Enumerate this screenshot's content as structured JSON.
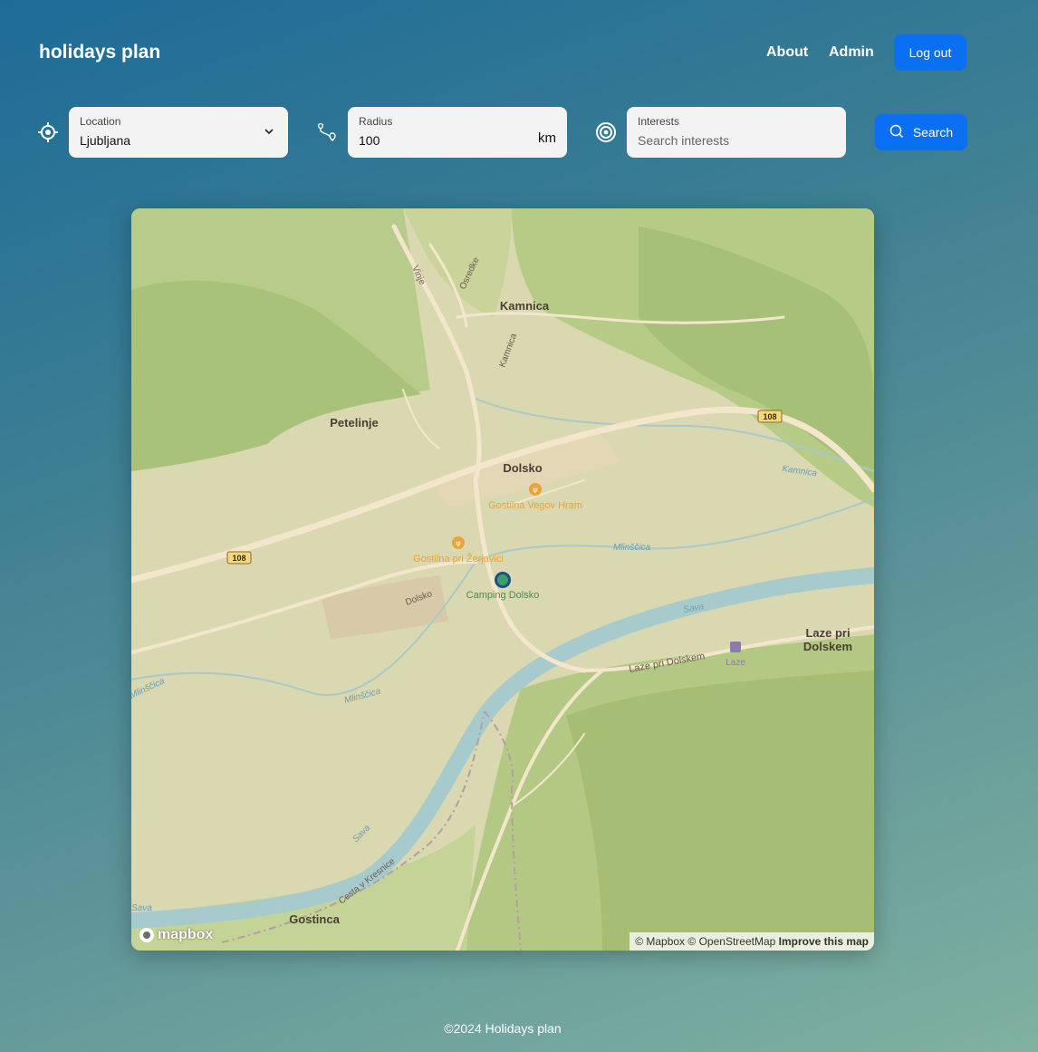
{
  "header": {
    "brand": "holidays plan",
    "nav": {
      "about": "About",
      "admin": "Admin",
      "logout": "Log out"
    }
  },
  "search": {
    "location": {
      "label": "Location",
      "value": "Ljubljana"
    },
    "radius": {
      "label": "Radius",
      "value": "100",
      "unit": "km"
    },
    "interests": {
      "label": "Interests",
      "placeholder": "Search interests"
    },
    "button": "Search"
  },
  "map": {
    "places": {
      "kamnica": "Kamnica",
      "petelinje": "Petelinje",
      "dolsko": "Dolsko",
      "laze_line1": "Laze pri",
      "laze_line2": "Dolskem",
      "gostinca": "Gostinca",
      "laze_station": "Laze"
    },
    "pois": {
      "vegov": "Gostilna Vegov Hram",
      "zerjavici": "Gostilna pri Žerjavici",
      "camping": "Camping Dolsko"
    },
    "roads": {
      "vinje": "Vinje",
      "osredke": "Osredke",
      "kamnica_road": "Kamnica",
      "dolsko_road": "Dolsko",
      "laze_road": "Laze pri Dolskem",
      "cesta": "Cesta v Kresnice",
      "route_108a": "108",
      "route_108b": "108"
    },
    "water": {
      "kamnica_creek": "Kamnica",
      "mlinscica_a": "Mlinščica",
      "mlinscica_b": "Mlinščica",
      "mlinscica_c": "Mlinščica",
      "sava_a": "Sava",
      "sava_b": "Sava",
      "sava_c": "Sava"
    },
    "attribution": {
      "mapbox": "© Mapbox",
      "osm": "© OpenStreetMap",
      "improve": "Improve this map"
    },
    "logo": "mapbox"
  },
  "footer": "©2024 Holidays plan",
  "colors": {
    "primary": "#0b6ff4",
    "poi": "#e8a33b",
    "water": "#a8cbcd",
    "road": "#f4e6cc"
  }
}
